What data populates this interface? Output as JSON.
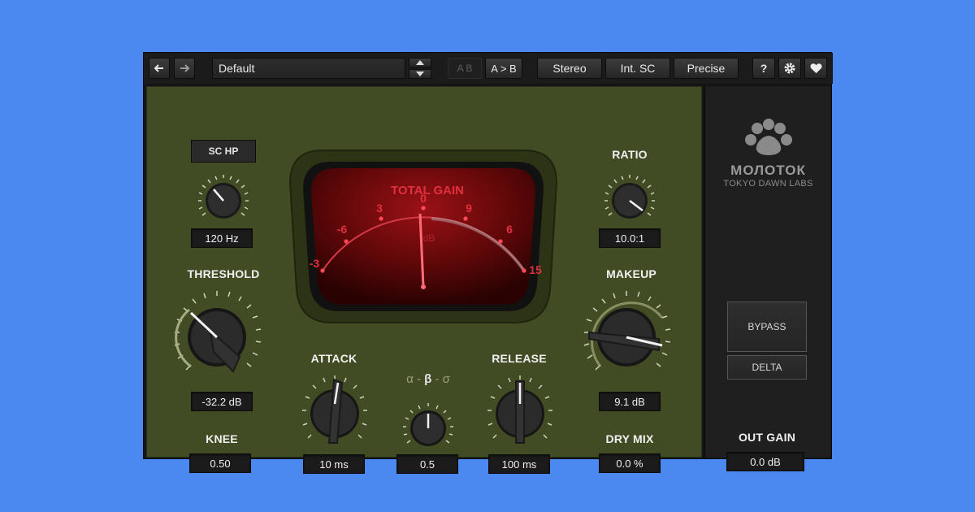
{
  "toolbar": {
    "preset_name": "Default",
    "ab_label": "A B",
    "a_to_b_label": "A > B",
    "stereo_label": "Stereo",
    "int_sc_label": "Int. SC",
    "precise_label": "Precise",
    "help_label": "?"
  },
  "meter": {
    "title": "TOTAL GAIN",
    "unit": "dB",
    "scale": [
      "-3",
      "-6",
      "3",
      "0",
      "9",
      "6",
      "15"
    ]
  },
  "controls": {
    "sc_hp": {
      "label": "SC HP",
      "value": "120 Hz"
    },
    "threshold": {
      "label": "THRESHOLD",
      "value": "-32.2 dB"
    },
    "knee": {
      "label": "KNEE",
      "value": "0.50"
    },
    "attack": {
      "label": "ATTACK",
      "value": "10 ms"
    },
    "alpha_beta_sigma": {
      "label_a": "α",
      "label_b": "β",
      "label_c": "σ",
      "sep": "-",
      "value": "0.5"
    },
    "release": {
      "label": "RELEASE",
      "value": "100 ms"
    },
    "ratio": {
      "label": "RATIO",
      "value": "10.0:1"
    },
    "makeup": {
      "label": "MAKEUP",
      "value": "9.1 dB"
    },
    "dry_mix": {
      "label": "DRY MIX",
      "value": "0.0 %"
    }
  },
  "side": {
    "brand": "МОЛОТОК",
    "company": "TOKYO DAWN LABS",
    "bypass_label": "BYPASS",
    "delta_label": "DELTA",
    "out_gain_label": "OUT GAIN",
    "out_gain_value": "0.0 dB"
  },
  "colors": {
    "panel": "#424c24",
    "meter_red": "#c0222c",
    "background": "#4b88f0"
  }
}
